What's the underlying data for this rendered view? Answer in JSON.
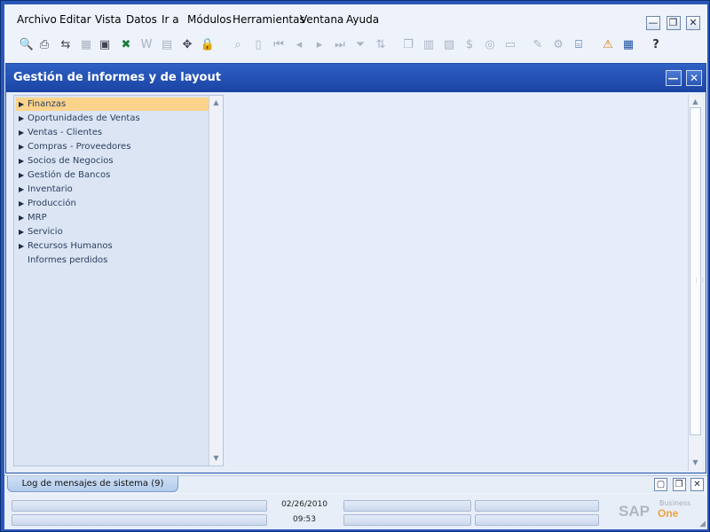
{
  "menubar": {
    "items": [
      {
        "label": "Archivo",
        "key": "A"
      },
      {
        "label": "Editar",
        "key": "E"
      },
      {
        "label": "Vista",
        "key": "V"
      },
      {
        "label": "Datos",
        "key": "D"
      },
      {
        "label": "Ir a",
        "key": "I"
      },
      {
        "label": "Módulos",
        "key": "M"
      },
      {
        "label": "Herramientas",
        "key": "H"
      },
      {
        "label": "Ventana",
        "key": "V"
      },
      {
        "label": "Ayuda",
        "key": "y"
      }
    ]
  },
  "window_controls": {
    "minimize": "—",
    "restore": "❐",
    "close": "✕"
  },
  "toolbar": {
    "icons": [
      "print-preview-icon",
      "print-icon",
      "refresh-icon",
      "calculator-icon",
      "open-icon",
      "excel-icon",
      "word-icon",
      "pdf-icon",
      "move-icon",
      "lock-icon",
      "find-icon",
      "add-icon",
      "first-record-icon",
      "previous-record-icon",
      "next-record-icon",
      "last-record-icon",
      "filter-icon",
      "sort-icon",
      "copy-document-icon",
      "base-document-icon",
      "target-document-icon",
      "payment-icon",
      "payment-means-icon",
      "messages-icon",
      "edit-icon",
      "settings-icon",
      "query-icon",
      "alert-icon",
      "calendar-icon",
      "help-icon"
    ]
  },
  "form": {
    "title": "Gestión de informes y de layout",
    "controls": {
      "minimize": "—",
      "close": "✕"
    }
  },
  "tree": {
    "items": [
      {
        "label": "Finanzas",
        "expandable": true,
        "selected": true
      },
      {
        "label": "Oportunidades de Ventas",
        "expandable": true
      },
      {
        "label": "Ventas - Clientes",
        "expandable": true
      },
      {
        "label": "Compras - Proveedores",
        "expandable": true
      },
      {
        "label": "Socios de Negocios",
        "expandable": true
      },
      {
        "label": "Gestión de Bancos",
        "expandable": true
      },
      {
        "label": "Inventario",
        "expandable": true
      },
      {
        "label": "Producción",
        "expandable": true
      },
      {
        "label": "MRP",
        "expandable": true
      },
      {
        "label": "Servicio",
        "expandable": true
      },
      {
        "label": "Recursos Humanos",
        "expandable": true
      },
      {
        "label": "Informes perdidos",
        "expandable": false
      }
    ]
  },
  "bottom_tab": {
    "label": "Log de mensajes de sistema (9)"
  },
  "status": {
    "date": "02/26/2010",
    "time": "09:53"
  },
  "logo": {
    "brand": "SAP",
    "product_small": "Business",
    "product": "One"
  },
  "colors": {
    "title_bar": "#1f4fb0",
    "selected_item": "#fbd38a",
    "logo_orange": "#f0a23c"
  }
}
